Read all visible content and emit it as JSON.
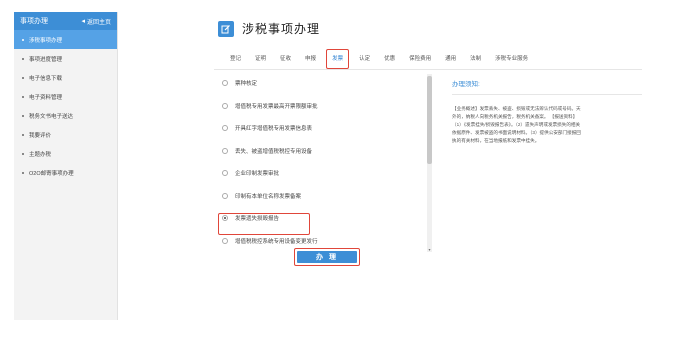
{
  "sidebar": {
    "header": "事项办理",
    "back_label": "返回主页",
    "items": [
      {
        "label": "涉税事项办理",
        "active": true
      },
      {
        "label": "事项进度管理",
        "active": false
      },
      {
        "label": "电子信息下载",
        "active": false
      },
      {
        "label": "电子资料管理",
        "active": false
      },
      {
        "label": "税务文书电子送达",
        "active": false
      },
      {
        "label": "我要评价",
        "active": false
      },
      {
        "label": "主题办税",
        "active": false
      },
      {
        "label": "O2O邮寄事项办理",
        "active": false
      }
    ]
  },
  "main": {
    "title": "涉税事项办理",
    "tabs": [
      "登记",
      "证明",
      "征收",
      "申报",
      "发票",
      "认定",
      "优惠",
      "保险费用",
      "通用",
      "法制",
      "涉税专业服务"
    ],
    "active_tab_index": 4,
    "items": [
      {
        "label": "票种核定",
        "checked": false
      },
      {
        "label": "增值税专用发票最高开票限额审批",
        "checked": false
      },
      {
        "label": "开具红字增值税专用发票信息表",
        "checked": false
      },
      {
        "label": "丢失、被盗增值税税控专用设备",
        "checked": false
      },
      {
        "label": "企业印制发票审批",
        "checked": false
      },
      {
        "label": "印制有本单位名称发票备案",
        "checked": false
      },
      {
        "label": "发票遗失损毁报告",
        "checked": true
      },
      {
        "label": "增值税税控系统专用设备变更发行",
        "checked": false
      }
    ],
    "submit_label": "办 理",
    "notice": {
      "title": "办理须知:",
      "lines": [
        "【业务概述】发票丢失、被盗、损毁或无法辨认代码或号码。天",
        "外的，纳税人向税务机关报告，税务机关备案。 【报送资料】",
        "（1）《发票挂失/损毁报告表》。（2）遗失声明或发票损失的相关",
        "依据原件、发票被盗的书面说明材料。（3）提供公安部门接报回",
        "执的有关材料，在当地报纸和发票中挂失。"
      ]
    }
  },
  "colors": {
    "primary": "#3d8ed6",
    "active_item": "#55a2e6",
    "highlight": "#e0463a"
  }
}
